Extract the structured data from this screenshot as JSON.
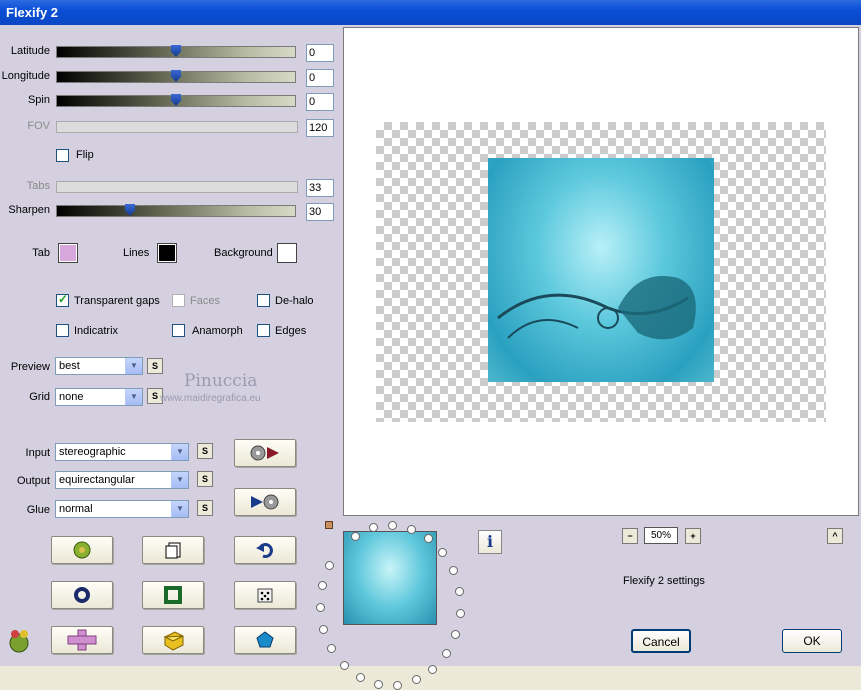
{
  "window": {
    "title": "Flexify 2"
  },
  "params": {
    "latitude": {
      "label": "Latitude",
      "value": "0",
      "fraction": 0.5
    },
    "longitude": {
      "label": "Longitude",
      "value": "0",
      "fraction": 0.5
    },
    "spin": {
      "label": "Spin",
      "value": "0",
      "fraction": 0.5
    },
    "fov": {
      "label": "FOV",
      "value": "120"
    },
    "flip": {
      "label": "Flip",
      "checked": false
    },
    "tabs": {
      "label": "Tabs",
      "value": "33"
    },
    "sharpen": {
      "label": "Sharpen",
      "value": "30",
      "fraction": 0.3
    }
  },
  "colors": {
    "tab": {
      "label": "Tab",
      "value": "#d8a8dc"
    },
    "lines": {
      "label": "Lines",
      "value": "#000000"
    },
    "background": {
      "label": "Background",
      "value": "#ffffff"
    }
  },
  "options": {
    "transparent_gaps": {
      "label": "Transparent gaps",
      "checked": true
    },
    "faces": {
      "label": "Faces",
      "checked": false
    },
    "dehalo": {
      "label": "De-halo",
      "checked": false
    },
    "indicatrix": {
      "label": "Indicatrix",
      "checked": false
    },
    "anamorph": {
      "label": "Anamorph",
      "checked": false
    },
    "edges": {
      "label": "Edges",
      "checked": false
    }
  },
  "selects": {
    "preview": {
      "label": "Preview",
      "value": "best"
    },
    "grid": {
      "label": "Grid",
      "value": "none"
    },
    "input": {
      "label": "Input",
      "value": "stereographic"
    },
    "output": {
      "label": "Output",
      "value": "equirectangular"
    },
    "glue": {
      "label": "Glue",
      "value": "normal"
    },
    "s_label": "S"
  },
  "watermark": {
    "name": "Pinuccia",
    "url": "www.maidiregrafica.eu"
  },
  "zoom": {
    "minus": "−",
    "value": "50%",
    "plus": "+"
  },
  "info_label": "i",
  "scroll_up": "^",
  "settings_label": "Flexify 2 settings",
  "buttons": {
    "cancel": "Cancel",
    "ok": "OK"
  },
  "icons": [
    "apply-arrow-icon",
    "reverse-arrow-icon",
    "globe-icon",
    "copy-icon",
    "undo-icon",
    "ring-icon",
    "square-icon",
    "dice-icon",
    "cross-icon",
    "cube-icon",
    "pentagon-icon",
    "logo-icon"
  ]
}
